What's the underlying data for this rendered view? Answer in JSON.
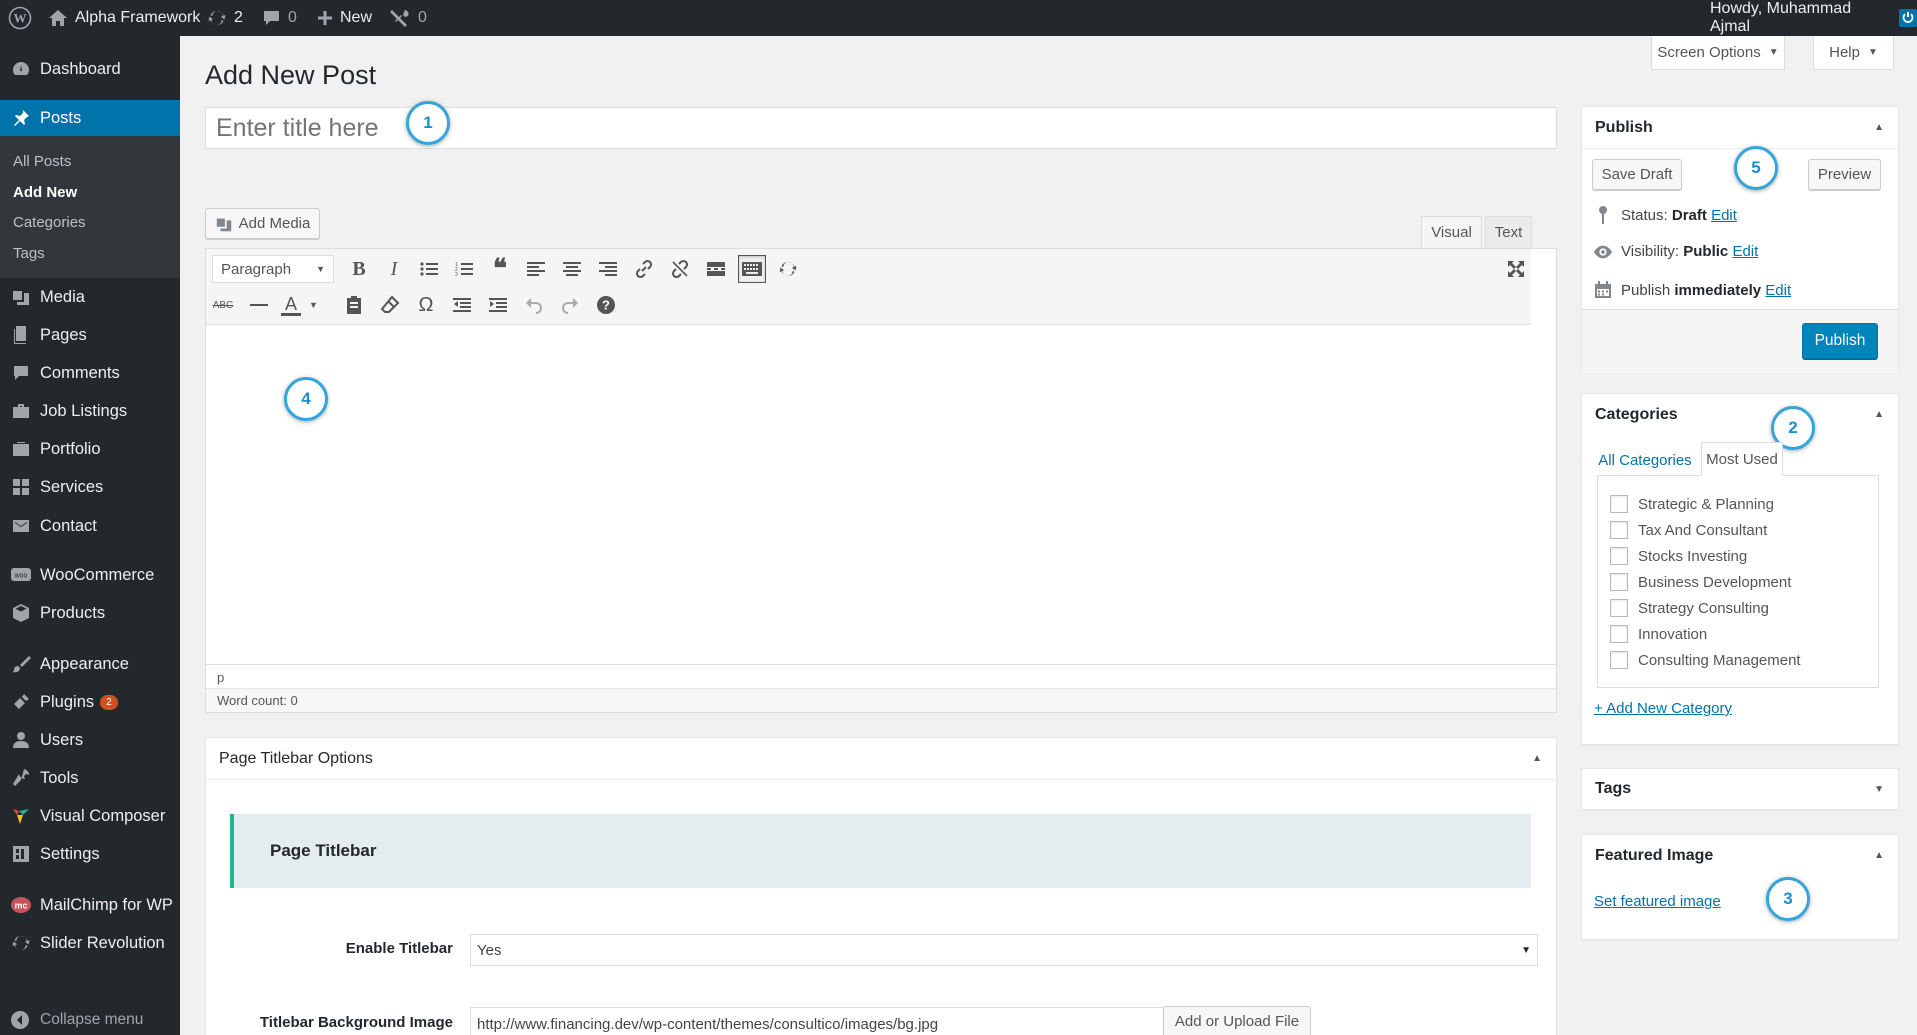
{
  "admin_bar": {
    "site_name": "Alpha Framework",
    "updates_count": "2",
    "comments_count": "0",
    "new_label": "New",
    "plugin_count": "0",
    "greeting": "Howdy, Muhammad Ajmal"
  },
  "sidebar": {
    "items": [
      {
        "label": "Dashboard",
        "icon": "dashboard-icon"
      },
      {
        "label": "Posts",
        "icon": "pin-icon"
      },
      {
        "label": "Media",
        "icon": "media-icon"
      },
      {
        "label": "Pages",
        "icon": "pages-icon"
      },
      {
        "label": "Comments",
        "icon": "comment-icon"
      },
      {
        "label": "Job Listings",
        "icon": "briefcase-icon"
      },
      {
        "label": "Portfolio",
        "icon": "portfolio-icon"
      },
      {
        "label": "Services",
        "icon": "grid-icon"
      },
      {
        "label": "Contact",
        "icon": "email-icon"
      },
      {
        "label": "WooCommerce",
        "icon": "woocommerce-icon"
      },
      {
        "label": "Products",
        "icon": "box-icon"
      },
      {
        "label": "Appearance",
        "icon": "brush-icon"
      },
      {
        "label": "Plugins",
        "icon": "plugin-icon",
        "badge": "2"
      },
      {
        "label": "Users",
        "icon": "users-icon"
      },
      {
        "label": "Tools",
        "icon": "wrench-icon"
      },
      {
        "label": "Visual Composer",
        "icon": "vc-icon"
      },
      {
        "label": "Settings",
        "icon": "settings-icon"
      },
      {
        "label": "MailChimp for WP",
        "icon": "mailchimp-icon"
      },
      {
        "label": "Slider Revolution",
        "icon": "refresh-icon"
      }
    ],
    "submenu": [
      "All Posts",
      "Add New",
      "Categories",
      "Tags"
    ],
    "collapse": "Collapse menu"
  },
  "header": {
    "title": "Add New Post",
    "screen_options": "Screen Options",
    "help": "Help"
  },
  "title_field": {
    "placeholder": "Enter title here"
  },
  "editor": {
    "add_media": "Add Media",
    "tab_visual": "Visual",
    "tab_text": "Text",
    "format": "Paragraph",
    "text_color_glyph": "A",
    "path": "p",
    "word_count": "Word count: 0"
  },
  "publish": {
    "title": "Publish",
    "save_draft": "Save Draft",
    "preview": "Preview",
    "status_label": "Status:",
    "status_value": "Draft",
    "visibility_label": "Visibility:",
    "visibility_value": "Public",
    "schedule_label": "Publish",
    "schedule_value": "immediately",
    "edit": "Edit",
    "publish_button": "Publish"
  },
  "categories": {
    "title": "Categories",
    "tab_all": "All Categories",
    "tab_most_used": "Most Used",
    "items": [
      "Strategic & Planning",
      "Tax And Consultant",
      "Stocks Investing",
      "Business Development",
      "Strategy Consulting",
      "Innovation",
      "Consulting Management"
    ],
    "add_new": "+ Add New Category"
  },
  "tags": {
    "title": "Tags"
  },
  "featured_image": {
    "title": "Featured Image",
    "link": "Set featured image"
  },
  "titlebar_options": {
    "title": "Page Titlebar Options",
    "section": "Page Titlebar",
    "enable_label": "Enable Titlebar",
    "enable_value": "Yes",
    "bg_label": "Titlebar Background Image",
    "bg_value": "http://www.financing.dev/wp-content/themes/consultico/images/bg.jpg",
    "upload_button": "Add or Upload File"
  },
  "callouts": [
    "1",
    "2",
    "3",
    "4",
    "5"
  ],
  "colors": {
    "accent": "#0073aa",
    "admin_bar": "#23282d",
    "publish": "#0085ba",
    "callout": "#34a5dc"
  }
}
